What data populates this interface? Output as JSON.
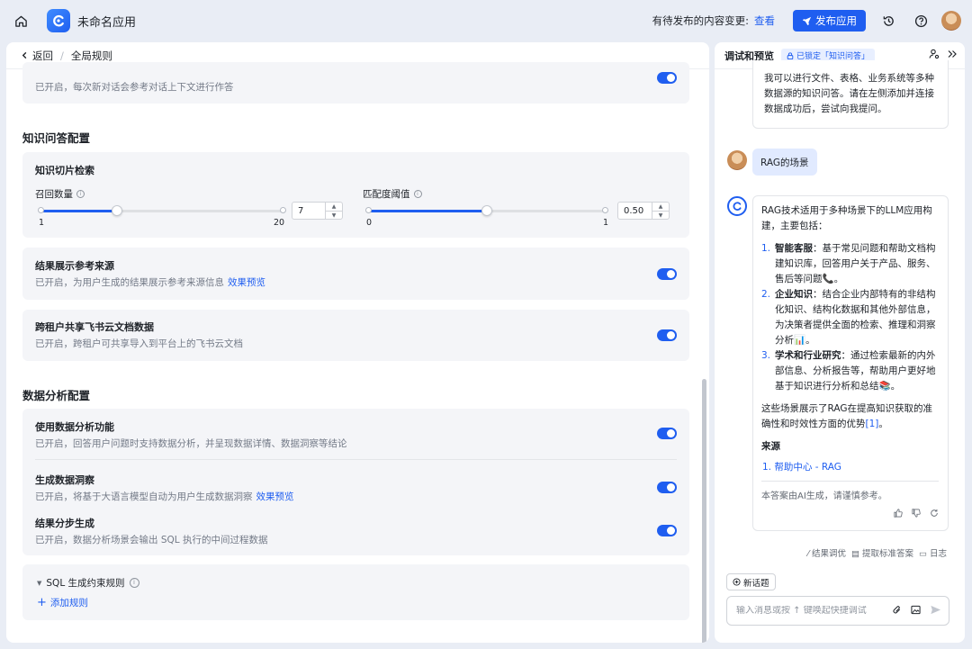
{
  "topbar": {
    "app_name": "未命名应用",
    "pending_text": "有待发布的内容变更:",
    "pending_link": "查看",
    "publish_label": "发布应用"
  },
  "left": {
    "back_label": "返回",
    "breadcrumb_sep": "/",
    "page_title": "全局规则",
    "partial_card": {
      "desc": "已开启，每次新对话会参考对话上下文进行作答"
    },
    "kqa": {
      "section_title": "知识问答配置",
      "retrieval": {
        "title": "知识切片检索",
        "recall": {
          "label": "召回数量",
          "min": "1",
          "max": "20",
          "value": "7",
          "fraction": 0.315
        },
        "threshold": {
          "label": "匹配度阈值",
          "min": "0",
          "max": "1",
          "value": "0.50",
          "fraction": 0.5
        }
      },
      "show_source": {
        "title": "结果展示参考来源",
        "desc": "已开启，为用户生成的结果展示参考来源信息",
        "link": "效果预览",
        "enabled": true
      },
      "cross_tenant": {
        "title": "跨租户共享飞书云文档数据",
        "desc": "已开启，跨租户可共享导入到平台上的飞书云文档",
        "enabled": true
      }
    },
    "da": {
      "section_title": "数据分析配置",
      "use_analysis": {
        "title": "使用数据分析功能",
        "desc": "已开启，回答用户问题时支持数据分析，并呈现数据详情、数据洞察等结论",
        "enabled": true
      },
      "insight": {
        "title": "生成数据洞察",
        "desc": "已开启，将基于大语言模型自动为用户生成数据洞察",
        "link": "效果预览",
        "enabled": true
      },
      "stepwise": {
        "title": "结果分步生成",
        "desc": "已开启，数据分析场景会输出 SQL 执行的中间过程数据",
        "enabled": true
      },
      "sql_rules": {
        "title": "SQL 生成约束规则",
        "add_label": "添加规则"
      }
    }
  },
  "right": {
    "title": "调试和预览",
    "locked_badge": "已锁定「知识问答」",
    "intro_message": "我可以进行文件、表格、业务系统等多种数据源的知识问答。请在左侧添加并连接数据成功后，尝试向我提问。",
    "user_message": "RAG的场景",
    "answer": {
      "intro": "RAG技术适用于多种场景下的LLM应用构建，主要包括：",
      "items": [
        {
          "num": "1.",
          "bold": "智能客服",
          "text": "：基于常见问题和帮助文档构建知识库，回答用户关于产品、服务、售后等问题📞。"
        },
        {
          "num": "2.",
          "bold": "企业知识",
          "text": "：结合企业内部特有的非结构化知识、结构化数据和其他外部信息，为决策者提供全面的检索、推理和洞察分析📊。"
        },
        {
          "num": "3.",
          "bold": "学术和行业研究",
          "text": "：通过检索最新的内外部信息、分析报告等，帮助用户更好地基于知识进行分析和总结📚。"
        }
      ],
      "summary": "这些场景展示了RAG在提高知识获取的准确性和时效性方面的优势",
      "summary_ref": "[1]",
      "summary_end": "。",
      "sources_title": "来源",
      "sources": [
        {
          "num": "1.",
          "text": "帮助中心 - RAG"
        }
      ],
      "disclaimer": "本答案由AI生成，请谨慎参考。"
    },
    "tools": {
      "tune": "结果调优",
      "extract": "提取标准答案",
      "log": "日志"
    },
    "new_topic": "新话题",
    "input_placeholder": "输入消息或按 ↑ 键唤起快捷调试"
  },
  "colors": {
    "accent": "#1f5ef0",
    "card_bg": "#f4f5f8",
    "page_bg": "#e9edf5"
  }
}
